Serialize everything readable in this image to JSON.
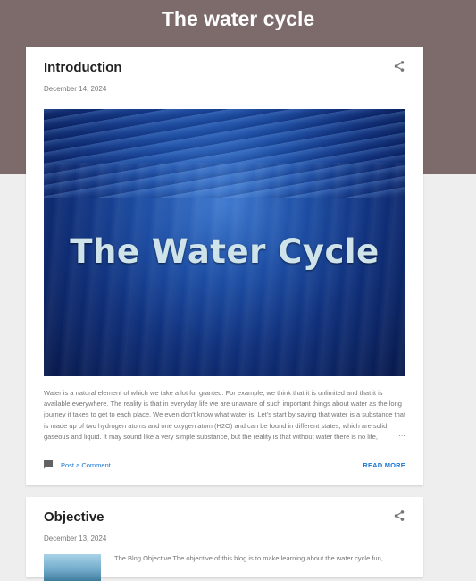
{
  "blog": {
    "title": "The water cycle"
  },
  "posts": [
    {
      "title": "Introduction",
      "date": "December 14, 2024",
      "hero_text": "The Water Cycle",
      "snippet": "Water is a natural element of which we take a lot for granted. For example, we think that it is unlimited and that it is available everywhere. The reality is that in everyday life we are unaware of such important things about water as the long journey it takes to get to each place. We even don't know what water is. Let's start by saying that water is a substance that is made up of two hydrogen atoms and one oxygen atom (H2O) and can be found in different states, which are solid, gaseous and liquid.  It may sound like a very simple substance, but the reality is that without water there is no life,",
      "ellipsis": "…",
      "comment_link": "Post a Comment",
      "read_more": "READ MORE"
    },
    {
      "title": "Objective",
      "date": "December 13, 2024",
      "snippet": "The Blog Objective The objective of this blog is to make learning about the water cycle fun,"
    }
  ],
  "icons": {
    "share": "share-icon",
    "comment": "comment-icon"
  },
  "colors": {
    "header_band": "#7d6b6b",
    "link": "#1976d2",
    "background": "#eeeeee"
  }
}
